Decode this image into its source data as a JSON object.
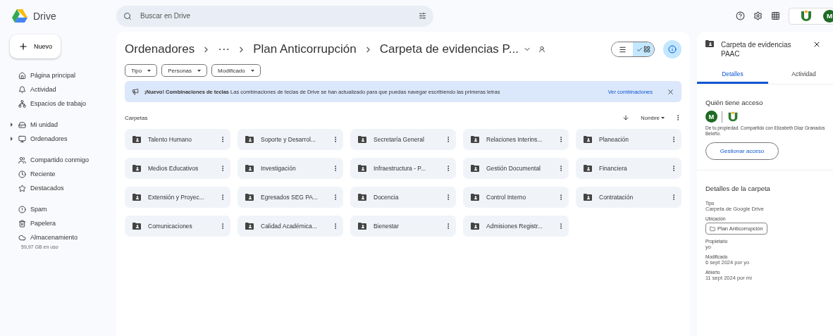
{
  "app": {
    "name": "Drive"
  },
  "search": {
    "placeholder": "Buscar en Drive"
  },
  "new_button": {
    "label": "Nuevo"
  },
  "sidebar": {
    "groups": [
      [
        {
          "label": "Página principal",
          "collapsible": false
        },
        {
          "label": "Actividad",
          "collapsible": false
        },
        {
          "label": "Espacios de trabajo",
          "collapsible": false
        }
      ],
      [
        {
          "label": "Mi unidad",
          "collapsible": true
        },
        {
          "label": "Ordenadores",
          "collapsible": true
        }
      ],
      [
        {
          "label": "Compartido conmigo",
          "collapsible": false
        },
        {
          "label": "Reciente",
          "collapsible": false
        },
        {
          "label": "Destacados",
          "collapsible": false
        }
      ],
      [
        {
          "label": "Spam",
          "collapsible": false
        },
        {
          "label": "Papelera",
          "collapsible": false
        },
        {
          "label": "Almacenamiento",
          "collapsible": false
        }
      ]
    ],
    "storage": "59,97 GB en uso"
  },
  "breadcrumb": [
    {
      "label": "Ordenadores"
    },
    {
      "label": "···"
    },
    {
      "label": "Plan Anticorrupción"
    },
    {
      "label": "Carpeta de evidencias P..."
    }
  ],
  "view_toggle": [
    {
      "kind": "list",
      "selected": false
    },
    {
      "kind": "grid",
      "selected": true
    }
  ],
  "filters": [
    "Tipo",
    "Personas",
    "Modificado"
  ],
  "banner": {
    "text": "**¡Nuevo! Combinaciones de teclas** Las combinaciones de teclas de Drive se han actualizado para que puedas navegar escribiendo las primeras letras",
    "link": "Ver combinaciones"
  },
  "section_title": "Carpetas",
  "sort": {
    "label": "Nombre"
  },
  "folders": [
    {
      "name": "Talento Humano"
    },
    {
      "name": "Soporte y Desarrol..."
    },
    {
      "name": "Secretaría General"
    },
    {
      "name": "Relaciones Interins..."
    },
    {
      "name": "Planeación"
    },
    {
      "name": "Medios Educativos"
    },
    {
      "name": "Investigación"
    },
    {
      "name": "Infraestructura - P..."
    },
    {
      "name": "Gestión Documental"
    },
    {
      "name": "Financiera"
    },
    {
      "name": "Extensión y Proyec..."
    },
    {
      "name": "Egresados SEG PA..."
    },
    {
      "name": "Docencia"
    },
    {
      "name": "Control Interno"
    },
    {
      "name": "Contratación"
    },
    {
      "name": "Comunicaciones"
    },
    {
      "name": "Calidad Académica..."
    },
    {
      "name": "Bienestar"
    },
    {
      "name": "Admisiones Registr..."
    }
  ],
  "account": {
    "initial": "M"
  },
  "details": {
    "title": "Carpeta de evidencias PAAC",
    "tabs": [
      {
        "label": "Detalles",
        "selected": true
      },
      {
        "label": "Actividad",
        "selected": false
      }
    ],
    "access_title": "Quién tiene acceso",
    "access_initial": "M",
    "access_text": "De tu propiedad. Compartido con Elizabeth Diaz Granados Beleño.",
    "manage_button": "Gestionar acceso",
    "section_title": "Detalles de la carpeta",
    "fields": [
      {
        "label": "Tipo",
        "value": "Carpeta de Google Drive",
        "kind": "text"
      },
      {
        "label": "Ubicación",
        "value": "Plan Anticorrupción",
        "kind": "chip"
      },
      {
        "label": "Propietario",
        "value": "yo",
        "kind": "text"
      },
      {
        "label": "Modificado",
        "value": "6 sept 2024 por yo",
        "kind": "text"
      },
      {
        "label": "Abierto",
        "value": "11 sept 2024 por mí",
        "kind": "text"
      }
    ]
  }
}
